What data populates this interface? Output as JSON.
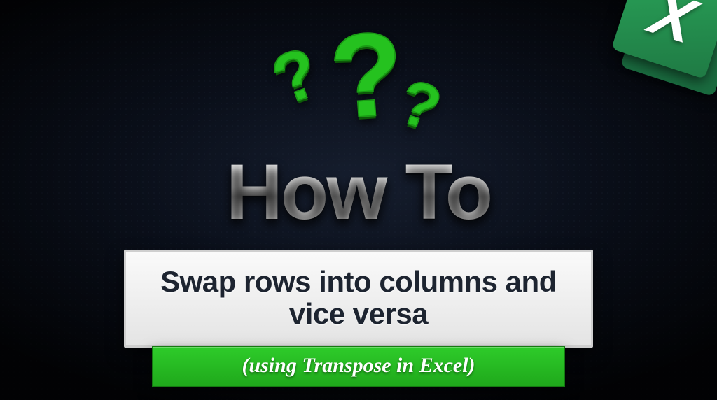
{
  "badge": {
    "letter": "X"
  },
  "qmarks": {
    "big": "?",
    "left": "?",
    "right": "?"
  },
  "title": "How To",
  "subtitle": "Swap rows into columns and vice versa",
  "note": "(using Transpose in Excel)"
}
